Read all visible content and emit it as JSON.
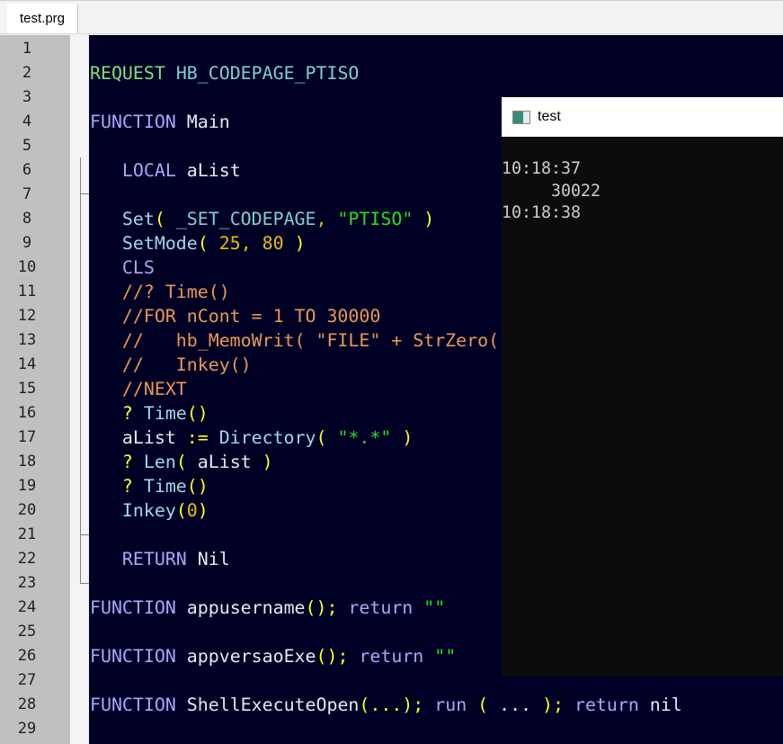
{
  "tab": {
    "label": "test.prg"
  },
  "editor": {
    "lines": [
      [],
      [
        [
          "rq",
          "REQUEST"
        ],
        [
          "id",
          " "
        ],
        [
          "cs",
          "HB_CODEPAGE_PTISO"
        ]
      ],
      [],
      [
        [
          "kw",
          "FUNCTION"
        ],
        [
          "id",
          " Main"
        ]
      ],
      [],
      [
        [
          "kw",
          "   LOCAL"
        ],
        [
          "id",
          " aList"
        ]
      ],
      [],
      [
        [
          "fn",
          "   Set"
        ],
        [
          "pa",
          "("
        ],
        [
          "id",
          " "
        ],
        [
          "cs",
          "_SET_CODEPAGE"
        ],
        [
          "nu",
          ","
        ],
        [
          "id",
          " "
        ],
        [
          "st",
          "\"PTISO\""
        ],
        [
          "id",
          " "
        ],
        [
          "pa",
          ")"
        ]
      ],
      [
        [
          "fn",
          "   SetMode"
        ],
        [
          "pa",
          "("
        ],
        [
          "id",
          " "
        ],
        [
          "nu",
          "25"
        ],
        [
          "nu",
          ","
        ],
        [
          "id",
          " "
        ],
        [
          "nu",
          "80"
        ],
        [
          "id",
          " "
        ],
        [
          "pa",
          ")"
        ]
      ],
      [
        [
          "kw",
          "   CLS"
        ]
      ],
      [
        [
          "cm",
          "   //? Time()"
        ]
      ],
      [
        [
          "cm",
          "   //FOR nCont = 1 TO 30000"
        ]
      ],
      [
        [
          "cm",
          "   //   hb_MemoWrit( \"FILE\" + StrZero("
        ]
      ],
      [
        [
          "cm",
          "   //   Inkey()"
        ]
      ],
      [
        [
          "cm",
          "   //NEXT"
        ]
      ],
      [
        [
          "op",
          "   ?"
        ],
        [
          "fn",
          " Time"
        ],
        [
          "pa",
          "()"
        ]
      ],
      [
        [
          "id",
          "   aList "
        ],
        [
          "op",
          ":="
        ],
        [
          "fn",
          " Directory"
        ],
        [
          "pa",
          "("
        ],
        [
          "id",
          " "
        ],
        [
          "st",
          "\"*.*\""
        ],
        [
          "id",
          " "
        ],
        [
          "pa",
          ")"
        ]
      ],
      [
        [
          "op",
          "   ?"
        ],
        [
          "fn",
          " Len"
        ],
        [
          "pa",
          "("
        ],
        [
          "id",
          " aList "
        ],
        [
          "pa",
          ")"
        ]
      ],
      [
        [
          "op",
          "   ?"
        ],
        [
          "fn",
          " Time"
        ],
        [
          "pa",
          "()"
        ]
      ],
      [
        [
          "fn",
          "   Inkey"
        ],
        [
          "pa",
          "("
        ],
        [
          "nu",
          "0"
        ],
        [
          "pa",
          ")"
        ]
      ],
      [],
      [
        [
          "kw",
          "   RETURN"
        ],
        [
          "id",
          " Nil"
        ]
      ],
      [],
      [
        [
          "kw",
          "FUNCTION"
        ],
        [
          "id",
          " appusername"
        ],
        [
          "pa",
          "()"
        ],
        [
          "op",
          ";"
        ],
        [
          "kw",
          " return"
        ],
        [
          "id",
          " "
        ],
        [
          "st",
          "\"\""
        ]
      ],
      [],
      [
        [
          "kw",
          "FUNCTION"
        ],
        [
          "id",
          " appversaoExe"
        ],
        [
          "pa",
          "()"
        ],
        [
          "op",
          ";"
        ],
        [
          "kw",
          " return"
        ],
        [
          "id",
          " "
        ],
        [
          "st",
          "\"\""
        ]
      ],
      [],
      [
        [
          "kw",
          "FUNCTION"
        ],
        [
          "id",
          " ShellExecuteOpen"
        ],
        [
          "pa",
          "(...)"
        ],
        [
          "op",
          ";"
        ],
        [
          "kw",
          " run"
        ],
        [
          "id",
          " "
        ],
        [
          "pa",
          "("
        ],
        [
          "id",
          " ... "
        ],
        [
          "pa",
          ")"
        ],
        [
          "op",
          ";"
        ],
        [
          "kw",
          " return"
        ],
        [
          "id",
          " nil"
        ]
      ],
      []
    ]
  },
  "console": {
    "title": "test",
    "output": [
      "10:18:37",
      "     30022",
      "10:18:38"
    ]
  }
}
